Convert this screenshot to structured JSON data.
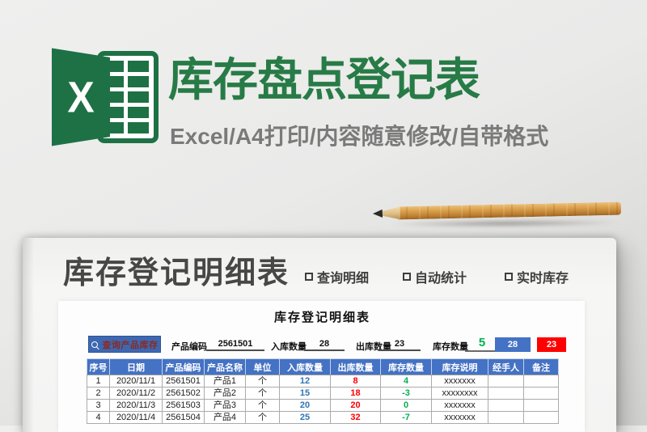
{
  "hero": {
    "logo_letter": "X",
    "title": "库存盘点登记表",
    "subtitle": "Excel/A4打印/内容随意修改/自带格式"
  },
  "paper": {
    "heading": "库存登记明细表",
    "features": [
      {
        "label": "查询明细"
      },
      {
        "label": "自动统计"
      },
      {
        "label": "实时库存"
      }
    ],
    "sheet": {
      "table_title": "库存登记明细表",
      "controls": {
        "search_button": "查询产品库存",
        "fields": [
          {
            "label": "产品编码",
            "value": "2561501"
          },
          {
            "label": "入库数量",
            "value": "28"
          },
          {
            "label": "出库数量",
            "value": "23"
          },
          {
            "label": "库存数量",
            "value": "5"
          }
        ],
        "in_total_box": "28",
        "out_total_box": "23"
      },
      "table": {
        "headers": [
          "序号",
          "日期",
          "产品编码",
          "产品名称",
          "单位",
          "入库数量",
          "出库数量",
          "库存数量",
          "库存说明",
          "经手人",
          "备注"
        ],
        "rows": [
          [
            "1",
            "2020/11/1",
            "2561501",
            "产品1",
            "个",
            "12",
            "8",
            "4",
            "xxxxxxx",
            "",
            ""
          ],
          [
            "2",
            "2020/11/2",
            "2561502",
            "产品2",
            "个",
            "15",
            "18",
            "-3",
            "xxxxxxxx",
            "",
            ""
          ],
          [
            "3",
            "2020/11/3",
            "2561503",
            "产品3",
            "个",
            "20",
            "20",
            "0",
            "xxxxxxx",
            "",
            ""
          ],
          [
            "4",
            "2020/11/4",
            "2561504",
            "产品4",
            "个",
            "25",
            "32",
            "-7",
            "xxxxxxx",
            "",
            ""
          ]
        ]
      }
    }
  },
  "colors": {
    "excel_green": "#1E7145",
    "title_green": "#277B46",
    "header_blue": "#4472C4",
    "in_blue": "#2E75B6",
    "out_red": "#FE0000",
    "stock_green": "#00B050",
    "button_text_red": "#8B2A22"
  }
}
